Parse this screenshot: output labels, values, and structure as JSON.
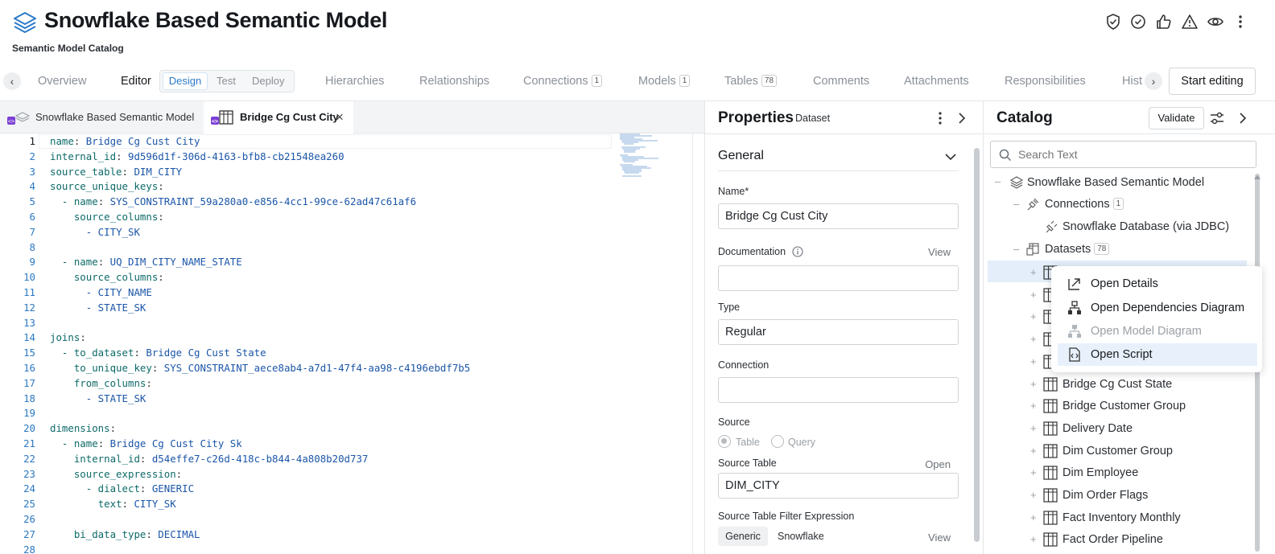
{
  "header": {
    "title": "Snowflake Based Semantic Model",
    "subtitle": "Semantic Model Catalog",
    "icons": [
      "shield-check-icon",
      "circle-check-icon",
      "thumbs-up-icon",
      "warning-icon",
      "eye-icon",
      "more-vertical-icon"
    ]
  },
  "tabs": {
    "overview": "Overview",
    "editor": "Editor",
    "design": "Design",
    "test": "Test",
    "deploy": "Deploy",
    "hierarchies": "Hierarchies",
    "relationships": "Relationships",
    "connections": "Connections",
    "connections_count": "1",
    "models": "Models",
    "models_count": "1",
    "tables": "Tables",
    "tables_count": "78",
    "comments": "Comments",
    "attachments": "Attachments",
    "responsibilities": "Responsibilities",
    "history": "Hist",
    "start_editing": "Start editing"
  },
  "editor": {
    "tab1": "Snowflake Based Semantic Model",
    "tab2": "Bridge Cg Cust City",
    "lines": [
      {
        "n": "1",
        "k": "name",
        "v": "Bridge Cg Cust City",
        "i": ""
      },
      {
        "n": "2",
        "k": "internal_id",
        "v": "9d596d1f-306d-4163-bfb8-cb21548ea260",
        "i": ""
      },
      {
        "n": "3",
        "k": "source_table",
        "v": "DIM_CITY",
        "i": ""
      },
      {
        "n": "4",
        "k": "source_unique_keys",
        "v": "",
        "i": ""
      },
      {
        "n": "5",
        "k": "- name",
        "v": "SYS_CONSTRAINT_59a280a0-e856-4cc1-99ce-62ad47c61af6",
        "i": "  "
      },
      {
        "n": "6",
        "k": "source_columns",
        "v": "",
        "i": "    "
      },
      {
        "n": "7",
        "k": "",
        "v": "- CITY_SK",
        "i": "      "
      },
      {
        "n": "8",
        "k": "",
        "v": "",
        "i": ""
      },
      {
        "n": "9",
        "k": "- name",
        "v": "UQ_DIM_CITY_NAME_STATE",
        "i": "  "
      },
      {
        "n": "10",
        "k": "source_columns",
        "v": "",
        "i": "    "
      },
      {
        "n": "11",
        "k": "",
        "v": "- CITY_NAME",
        "i": "      "
      },
      {
        "n": "12",
        "k": "",
        "v": "- STATE_SK",
        "i": "      "
      },
      {
        "n": "13",
        "k": "",
        "v": "",
        "i": ""
      },
      {
        "n": "14",
        "k": "joins",
        "v": "",
        "i": ""
      },
      {
        "n": "15",
        "k": "- to_dataset",
        "v": "Bridge Cg Cust State",
        "i": "  "
      },
      {
        "n": "16",
        "k": "to_unique_key",
        "v": "SYS_CONSTRAINT_aece8ab4-a7d1-47f4-aa98-c4196ebdf7b5",
        "i": "    "
      },
      {
        "n": "17",
        "k": "from_columns",
        "v": "",
        "i": "    "
      },
      {
        "n": "18",
        "k": "",
        "v": "- STATE_SK",
        "i": "      "
      },
      {
        "n": "19",
        "k": "",
        "v": "",
        "i": ""
      },
      {
        "n": "20",
        "k": "dimensions",
        "v": "",
        "i": ""
      },
      {
        "n": "21",
        "k": "- name",
        "v": "Bridge Cg Cust City Sk",
        "i": "  "
      },
      {
        "n": "22",
        "k": "internal_id",
        "v": "d54effe7-c26d-418c-b844-4a808b20d737",
        "i": "    "
      },
      {
        "n": "23",
        "k": "source_expression",
        "v": "",
        "i": "    "
      },
      {
        "n": "24",
        "k": "- dialect",
        "v": "GENERIC",
        "i": "      "
      },
      {
        "n": "25",
        "k": "text",
        "v": "CITY_SK",
        "i": "        "
      },
      {
        "n": "26",
        "k": "",
        "v": "",
        "i": ""
      },
      {
        "n": "27",
        "k": "bi_data_type",
        "v": "DECIMAL",
        "i": "    "
      },
      {
        "n": "28",
        "k": "",
        "v": "",
        "i": ""
      }
    ]
  },
  "properties": {
    "title": "Properties",
    "subtitle": "Dataset",
    "section": "General",
    "name_label": "Name*",
    "name_value": "Bridge Cg Cust City",
    "doc_label": "Documentation",
    "doc_link": "View",
    "doc_value": "",
    "type_label": "Type",
    "type_value": "Regular",
    "connection_label": "Connection",
    "connection_value": "",
    "source_label": "Source",
    "source_opt1": "Table",
    "source_opt2": "Query",
    "source_table_label": "Source Table",
    "source_table_link": "Open",
    "source_table_value": "DIM_CITY",
    "filter_label": "Source Table Filter Expression",
    "filter_tab1": "Generic",
    "filter_tab2": "Snowflake",
    "filter_link": "View"
  },
  "catalog": {
    "title": "Catalog",
    "validate": "Validate",
    "search_placeholder": "Search Text",
    "root": "Snowflake Based Semantic Model",
    "connections": "Connections",
    "connections_count": "1",
    "connection_item": "Snowflake Database (via JDBC)",
    "datasets": "Datasets",
    "datasets_count": "78",
    "items": [
      "Bridge Cg Cust State",
      "Bridge Customer Group",
      "Delivery Date",
      "Dim Customer Group",
      "Dim Employee",
      "Dim Order Flags",
      "Fact Inventory Monthly",
      "Fact Order Pipeline"
    ]
  },
  "context_menu": {
    "items": [
      {
        "label": "Open Details",
        "icon": "open-external-icon",
        "enabled": true
      },
      {
        "label": "Open Dependencies Diagram",
        "icon": "dependencies-diagram-icon",
        "enabled": true
      },
      {
        "label": "Open Model Diagram",
        "icon": "model-diagram-icon",
        "enabled": false
      },
      {
        "label": "Open Script",
        "icon": "script-file-icon",
        "enabled": true
      }
    ]
  }
}
